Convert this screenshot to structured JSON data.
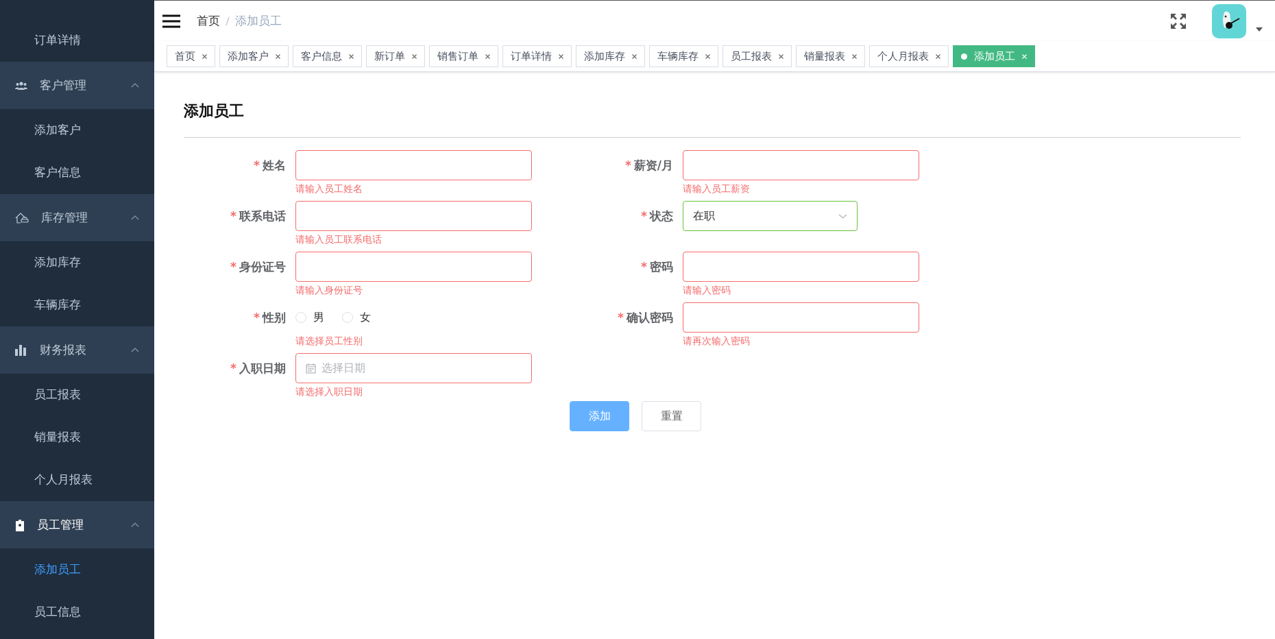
{
  "sidebar": {
    "items": [
      {
        "label": "订单详情",
        "selected": false
      }
    ],
    "groups": [
      {
        "label": "客户管理",
        "expanded": true,
        "children": [
          {
            "label": "添加客户",
            "selected": false
          },
          {
            "label": "客户信息",
            "selected": false
          }
        ]
      },
      {
        "label": "库存管理",
        "expanded": true,
        "children": [
          {
            "label": "添加库存",
            "selected": false
          },
          {
            "label": "车辆库存",
            "selected": false
          }
        ]
      },
      {
        "label": "财务报表",
        "expanded": true,
        "children": [
          {
            "label": "员工报表",
            "selected": false
          },
          {
            "label": "销量报表",
            "selected": false
          },
          {
            "label": "个人月报表",
            "selected": false
          }
        ]
      },
      {
        "label": "员工管理",
        "expanded": true,
        "children": [
          {
            "label": "添加员工",
            "selected": true
          },
          {
            "label": "员工信息",
            "selected": false
          }
        ]
      }
    ]
  },
  "header": {
    "breadcrumb": [
      {
        "label": "首页",
        "current": false
      },
      {
        "label": "添加员工",
        "current": true
      }
    ]
  },
  "tabs": [
    {
      "label": "首页",
      "selected": false
    },
    {
      "label": "添加客户",
      "selected": false
    },
    {
      "label": "客户信息",
      "selected": false
    },
    {
      "label": "新订单",
      "selected": false
    },
    {
      "label": "销售订单",
      "selected": false
    },
    {
      "label": "订单详情",
      "selected": false
    },
    {
      "label": "添加库存",
      "selected": false
    },
    {
      "label": "车辆库存",
      "selected": false
    },
    {
      "label": "员工报表",
      "selected": false
    },
    {
      "label": "销量报表",
      "selected": false
    },
    {
      "label": "个人月报表",
      "selected": false
    },
    {
      "label": "添加员工",
      "selected": true
    }
  ],
  "form": {
    "title": "添加员工",
    "required_mark": "*",
    "left": [
      {
        "kind": "text",
        "label": "姓名",
        "required": true,
        "invalid": true,
        "error": "请输入员工姓名"
      },
      {
        "kind": "text",
        "label": "联系电话",
        "required": true,
        "invalid": true,
        "error": "请输入员工联系电话"
      },
      {
        "kind": "text",
        "label": "身份证号",
        "required": true,
        "invalid": true,
        "error": "请输入身份证号"
      },
      {
        "kind": "radio",
        "label": "性别",
        "required": true,
        "invalid": true,
        "error": "请选择员工性别",
        "options": [
          {
            "label": "男",
            "selected": false
          },
          {
            "label": "女",
            "selected": false
          }
        ]
      },
      {
        "kind": "date",
        "label": "入职日期",
        "required": true,
        "invalid": true,
        "placeholder": "选择日期",
        "error": "请选择入职日期"
      }
    ],
    "right": [
      {
        "kind": "text",
        "label": "薪资/月",
        "required": true,
        "invalid": true,
        "error": "请输入员工薪资"
      },
      {
        "kind": "select",
        "label": "状态",
        "required": true,
        "invalid": false,
        "value": "在职"
      },
      {
        "kind": "text",
        "label": "密码",
        "required": true,
        "invalid": true,
        "error": "请输入密码"
      },
      {
        "kind": "text",
        "label": "确认密码",
        "required": true,
        "invalid": true,
        "error": "请再次输入密码"
      }
    ],
    "buttons": [
      {
        "label": "添加",
        "kind": "primary"
      },
      {
        "label": "重置",
        "kind": "default"
      }
    ]
  }
}
